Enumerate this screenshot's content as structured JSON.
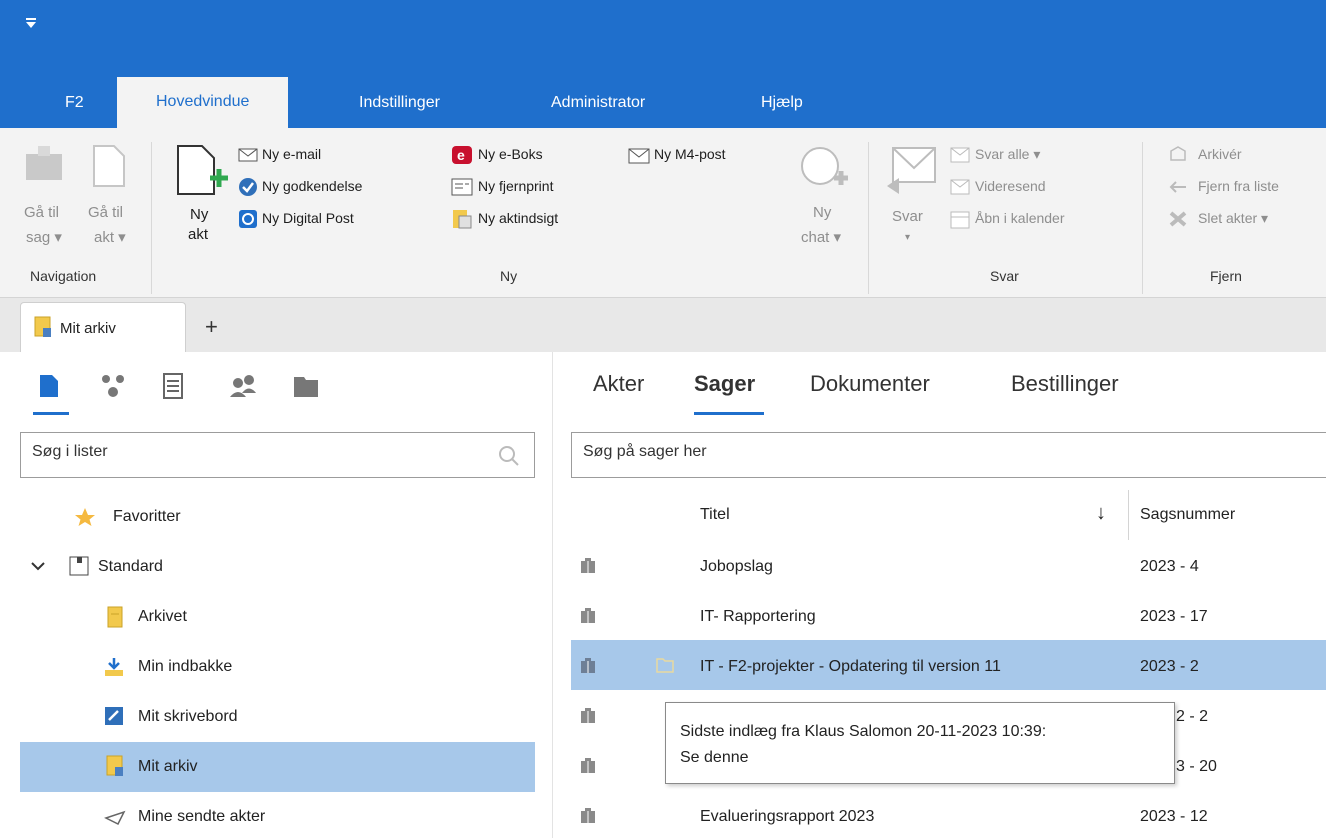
{
  "app": {
    "accent": "#1f6fcc",
    "quick_access_icon": "quick-access-menu-icon"
  },
  "menu": {
    "tabs": [
      "F2",
      "Hovedvindue",
      "Indstillinger",
      "Administrator",
      "Hjælp"
    ],
    "active": "Hovedvindue"
  },
  "ribbon": {
    "navigation": {
      "goto_case_top": "Gå til",
      "goto_case_bottom": "sag ▾",
      "goto_doc_top": "Gå til",
      "goto_doc_bottom": "akt ▾",
      "group_label": "Navigation"
    },
    "ny": {
      "new_doc_top": "Ny",
      "new_doc_bottom": "akt",
      "new_email": "Ny e-mail",
      "new_approval": "Ny godkendelse",
      "new_digital_post": "Ny Digital Post",
      "new_eboks": "Ny e-Boks",
      "new_remote_print": "Ny fjernprint",
      "new_access_request": "Ny aktindsigt",
      "new_m4": "Ny M4-post",
      "new_chat_top": "Ny",
      "new_chat_bottom": "chat ▾",
      "group_label": "Ny"
    },
    "svar": {
      "reply": "Svar",
      "reply_arrow": "▾",
      "reply_all": "Svar alle ▾",
      "forward": "Videresend",
      "open_calendar": "Åbn i kalender",
      "group_label": "Svar"
    },
    "fjern": {
      "archive": "Arkivér",
      "remove_from_list": "Fjern fra liste",
      "delete_docs": "Slet akter ▾",
      "group_label": "Fjern"
    }
  },
  "doc_tabs": {
    "active_label": "Mit arkiv",
    "add": "+"
  },
  "left": {
    "search_placeholder": "Søg i lister",
    "tree": {
      "favorites": "Favoritter",
      "standard": "Standard",
      "archive": "Arkivet",
      "inbox": "Min indbakke",
      "desk": "Mit skrivebord",
      "my_archive": "Mit arkiv",
      "sent": "Mine sendte akter"
    },
    "selected": "Mit arkiv"
  },
  "main": {
    "tabs": [
      "Akter",
      "Sager",
      "Dokumenter",
      "Bestillinger"
    ],
    "active_tab": "Sager",
    "search_placeholder": "Søg på sager her",
    "columns": {
      "title": "Titel",
      "sort": "↓",
      "case_number": "Sagsnummer"
    },
    "rows": [
      {
        "title": "Jobopslag",
        "number": "2023 - 4"
      },
      {
        "title": "IT- Rapportering",
        "number": "2023 - 17"
      },
      {
        "title": "IT - F2-projekter - Opdatering til version 11",
        "number": "2023 - 2"
      },
      {
        "title": "",
        "number": "2 - 2"
      },
      {
        "title": "",
        "number": "3 - 20"
      },
      {
        "title": "Evalueringsrapport 2023",
        "number": "2023 - 12"
      }
    ],
    "tooltip": {
      "line1": "Sidste indlæg fra Klaus Salomon 20-11-2023 10:39:",
      "line2": "Se denne"
    }
  }
}
